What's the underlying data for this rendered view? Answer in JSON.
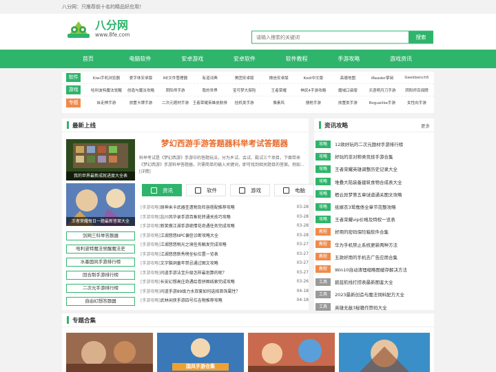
{
  "topbar": {
    "text": "八分网：只推荐前十名的精品好应用！"
  },
  "logo": {
    "title": "八分网",
    "url_text": "www.8fe.com"
  },
  "search": {
    "placeholder": "请输入搜索的关键词",
    "button": "搜索"
  },
  "nav": [
    "首页",
    "电脑软件",
    "安卓游戏",
    "安卓软件",
    "软件教程",
    "手游攻略",
    "游戏资讯"
  ],
  "categories": [
    {
      "tag": "软件",
      "color": "#2fb46b",
      "links": [
        "Kiwi手机浏览器",
        "爱字体安卓版",
        "RE文件管理器",
        "有道词典",
        "美团安卓版",
        "微信安卓版",
        "Kodi中文版",
        "高德地图",
        "iReader掌阅",
        "Geekbench5"
      ]
    },
    {
      "tag": "游戏",
      "color": "#2fb46b",
      "links": [
        "哈利波特魔法觉醒",
        "创造与魔法攻略",
        "阴阳师手游",
        "我的世界",
        "宝可梦大探险",
        "王者荣耀",
        "神武4手游攻略",
        "魔域口袋版",
        "天涯明月刀手游",
        "阴阳师百闻牌"
      ]
    },
    {
      "tag": "专题",
      "color": "#f08a4b",
      "links": [
        "自走棋手游",
        "放置卡牌手游",
        "二次元题材手游",
        "王者荣耀英雄皮肤排行榜",
        "挂机类手游",
        "像素风",
        "搜枪手游",
        "放置类手游",
        "Roguelike手游",
        "女性向手游"
      ]
    }
  ],
  "latest": {
    "title": "最新上线",
    "images": [
      {
        "caption": "我的世界最新成就进度大全表",
        "color": "#2e4a1c"
      },
      {
        "caption": "王者荣耀每日一题最新答案大全",
        "color": "#5a7fb8"
      }
    ],
    "side_links": [
      "剑网三科举答题器",
      "哈利波特魔法觉醒魔法史",
      "水墨国风手游排行榜",
      "回合制手游排行榜",
      "二次元手游排行榜",
      "自由幻想答题器"
    ],
    "featured": {
      "title": "梦幻西游手游答题器科举考试答题器",
      "desc": "科举考试是《梦幻西游》手游中的答题玩法，分为乡试、会试、殿试三个项目，下面带来《梦幻西游》手游科举答题器，只需简单的输入关键词，即可找到相关题目的答案。例如...",
      "detail": "[详情]"
    },
    "tabs": [
      "资讯",
      "软件",
      "游戏",
      "电脑"
    ],
    "news": [
      {
        "cat": "[手游攻略]",
        "title": "原神米卡武器圣遗物及阵容搭配推荐攻略",
        "date": "03-28"
      },
      {
        "cat": "[手游攻略]",
        "title": "忘川风华录手游百象轮转通关技巧攻略",
        "date": "03-28"
      },
      {
        "cat": "[手游攻略]",
        "title": "新笑傲江湖手游绝情花奇遇任务完成攻略",
        "date": "03-28"
      },
      {
        "cat": "[手游攻略]",
        "title": "江湖悠悠NPC偏信诊断攻略大全",
        "date": "03-28"
      },
      {
        "cat": "[手游攻略]",
        "title": "江湖悠悠税光之境任务触发完成攻略",
        "date": "03-27"
      },
      {
        "cat": "[手游攻略]",
        "title": "江湖悠悠新秀榜坐标位置一览表",
        "date": "03-27"
      },
      {
        "cat": "[手游攻略]",
        "title": "文字脑洞童年禁忌通过图文攻略",
        "date": "03-27"
      },
      {
        "cat": "[手游攻略]",
        "title": "问道手游法宝升级怎样最划算的呢？",
        "date": "03-27"
      },
      {
        "cat": "[手游攻略]",
        "title": "长安幻想高庄奇遇绘卷拼图线索完成攻略",
        "date": "03-26"
      },
      {
        "cat": "[手游攻略]",
        "title": "问道手游89级力水双套如何选择首饰属性？",
        "date": "04-18"
      },
      {
        "cat": "[手游攻略]",
        "title": "武林闲侠手游四号位吉物推荐攻略",
        "date": "04-18"
      }
    ]
  },
  "guides": {
    "title": "资讯攻略",
    "more": "更多",
    "items": [
      {
        "tag": "攻略",
        "color": "#2fb46b",
        "text": "12款好玩的二次元题材手游排行榜"
      },
      {
        "tag": "攻略",
        "color": "#2fb46b",
        "text": "好玩的非对称类竞技手游合集"
      },
      {
        "tag": "攻略",
        "color": "#2fb46b",
        "text": "王者荣耀英雄调整历史记录大全"
      },
      {
        "tag": "攻略",
        "color": "#2fb46b",
        "text": "堆叠大陆装备建筑食物合成表大全"
      },
      {
        "tag": "攻略",
        "color": "#2fb46b",
        "text": "栖云异梦第五章谜道通关图文攻略"
      },
      {
        "tag": "攻略",
        "color": "#2fb46b",
        "text": "纸嫁衣3鸳鸯债全章节完整攻略"
      },
      {
        "tag": "攻略",
        "color": "#2fb46b",
        "text": "王者荣耀vip价格及特权一览表"
      },
      {
        "tag": "教程",
        "color": "#f08a4b",
        "text": "好用的密码保险箱软件合集"
      },
      {
        "tag": "教程",
        "color": "#f08a4b",
        "text": "华为手机禁止系统更新两种方法"
      },
      {
        "tag": "教程",
        "color": "#f08a4b",
        "text": "五款好用的手机去广告应用合集"
      },
      {
        "tag": "教程",
        "color": "#f08a4b",
        "text": "Win10自动清理缩略图缓存解决方法"
      },
      {
        "tag": "工具",
        "color": "#999999",
        "text": "碧蓝航线打捞表最新图鉴大全"
      },
      {
        "tag": "工具",
        "color": "#999999",
        "text": "2023最新创造与魔法饲料配方大全"
      },
      {
        "tag": "工具",
        "color": "#999999",
        "text": "英雄无敌3秘籍作弊码大全"
      }
    ]
  },
  "topics": {
    "title": "专题合集",
    "thumbs": [
      {
        "color": "#9a6a4e",
        "caption": ""
      },
      {
        "color": "#3a78b8",
        "caption": "国风手游合集"
      },
      {
        "color": "#c96a4e",
        "caption": ""
      },
      {
        "color": "#3a8fc9",
        "caption": ""
      }
    ]
  }
}
